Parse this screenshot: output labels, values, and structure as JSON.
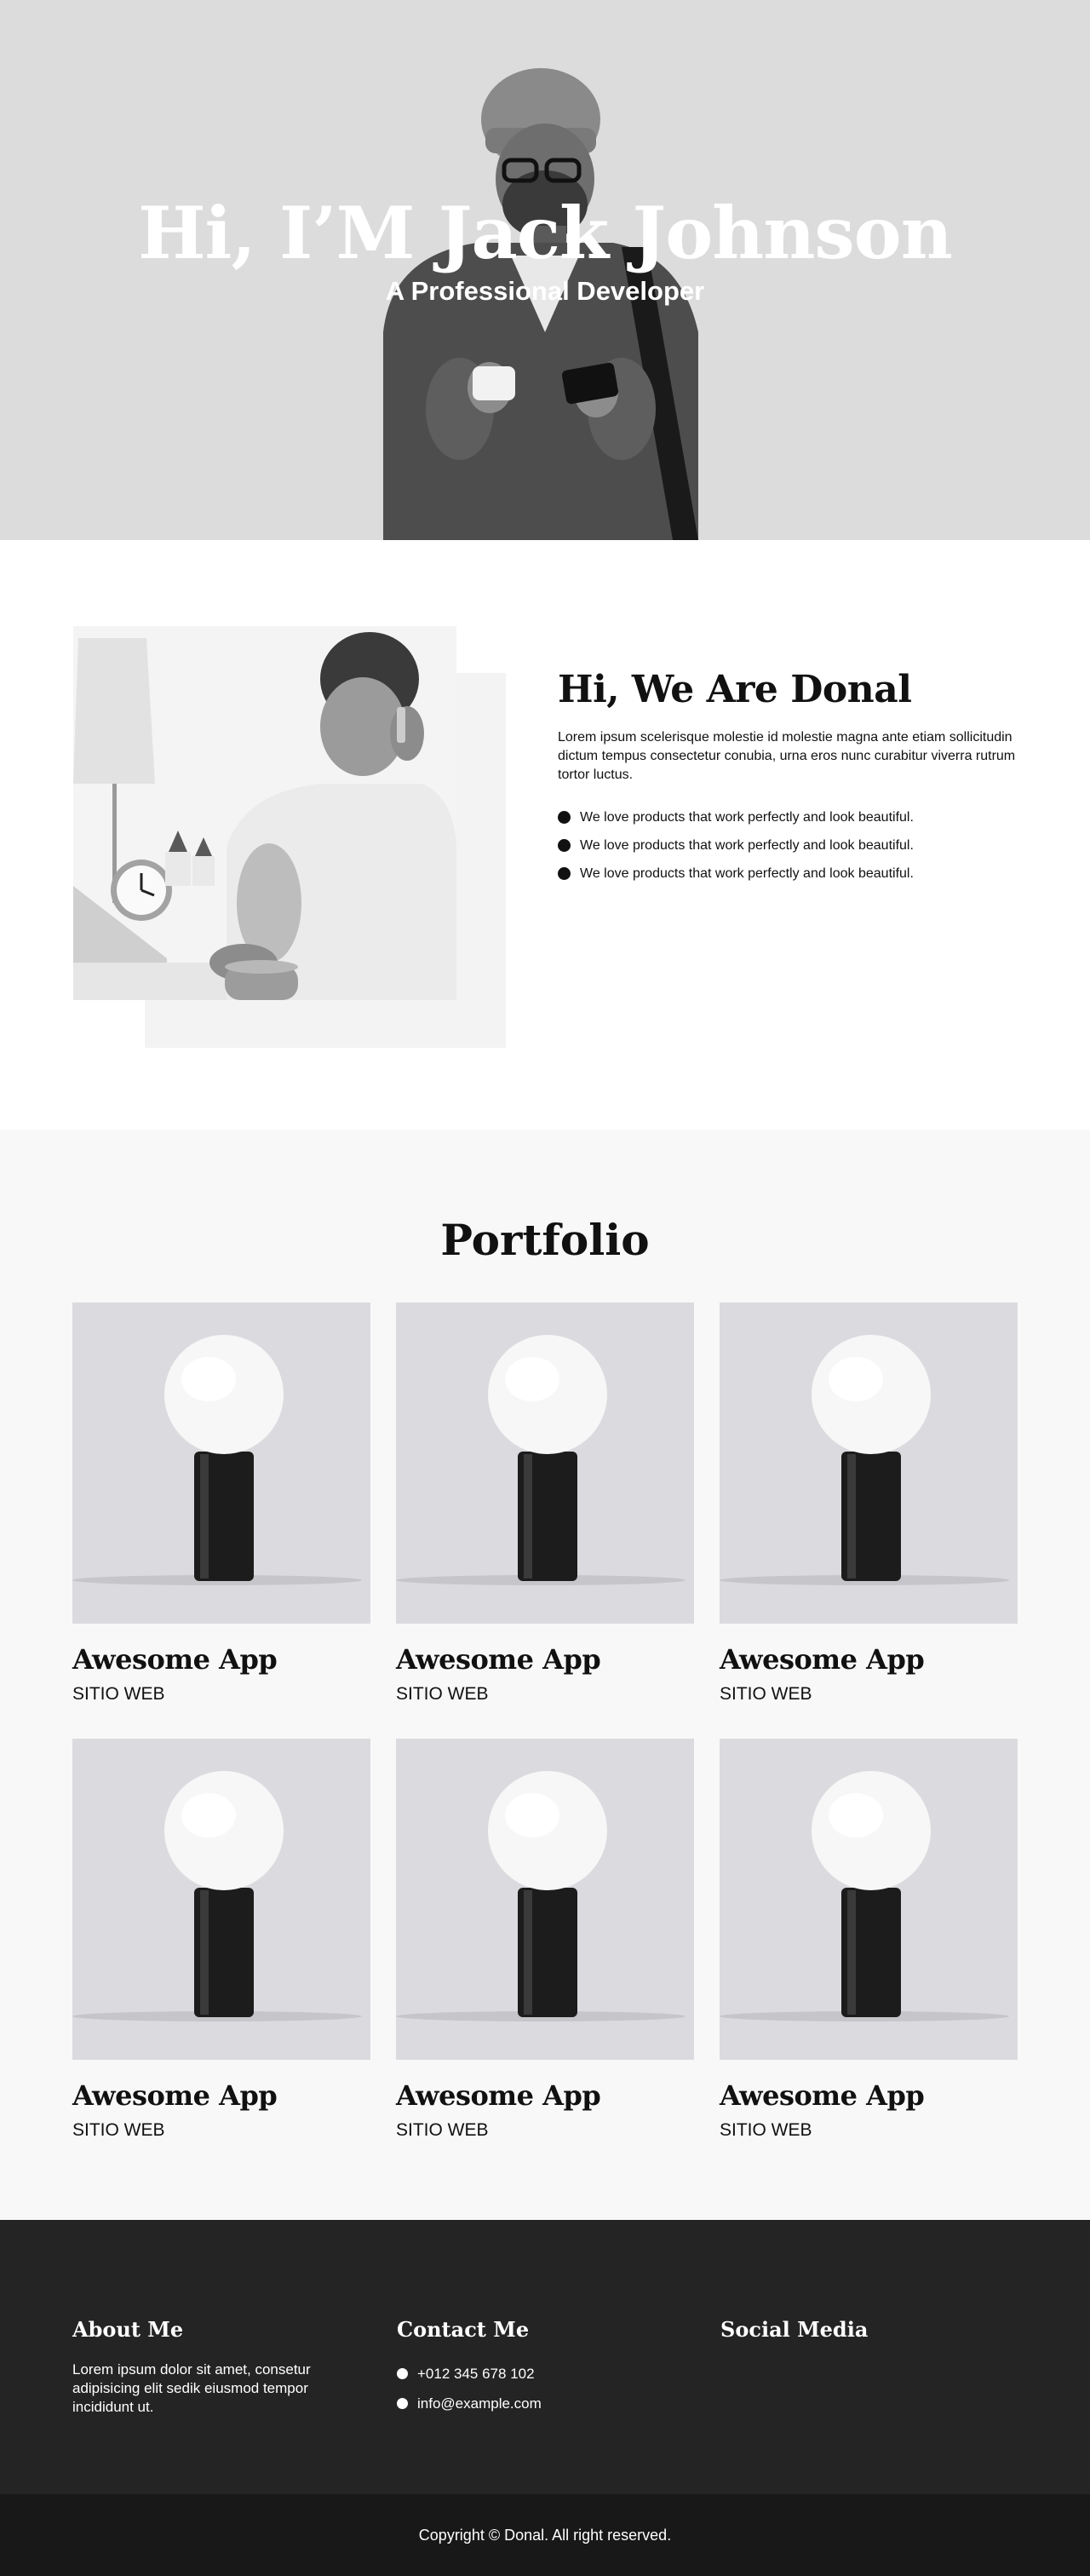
{
  "hero": {
    "title": "Hi, I’M Jack Johnson",
    "subtitle": "A Professional Developer"
  },
  "about": {
    "title": "Hi, We Are Donal",
    "paragraph": "Lorem ipsum scelerisque molestie id molestie magna ante etiam sollicitudin dictum tempus consectetur conubia, urna eros nunc curabitur viverra rutrum tortor luctus.",
    "features": [
      "We love products that work perfectly and look beautiful.",
      "We love products that work perfectly and look beautiful.",
      "We love products that work perfectly and look beautiful."
    ]
  },
  "portfolio": {
    "title": "Portfolio",
    "items": [
      {
        "title": "Awesome App",
        "category": "SITIO WEB"
      },
      {
        "title": "Awesome App",
        "category": "SITIO WEB"
      },
      {
        "title": "Awesome App",
        "category": "SITIO WEB"
      },
      {
        "title": "Awesome App",
        "category": "SITIO WEB"
      },
      {
        "title": "Awesome App",
        "category": "SITIO WEB"
      },
      {
        "title": "Awesome App",
        "category": "SITIO WEB"
      }
    ]
  },
  "footer": {
    "about_head": "About Me",
    "about_text": "Lorem ipsum dolor sit amet, consetur adipisicing elit sedik eiusmod tempor incididunt ut.",
    "contact_head": "Contact Me",
    "phone": "+012 345 678 102",
    "email": "info@example.com",
    "social_head": "Social Media"
  },
  "copyright": "Copyright © Donal. All right reserved."
}
